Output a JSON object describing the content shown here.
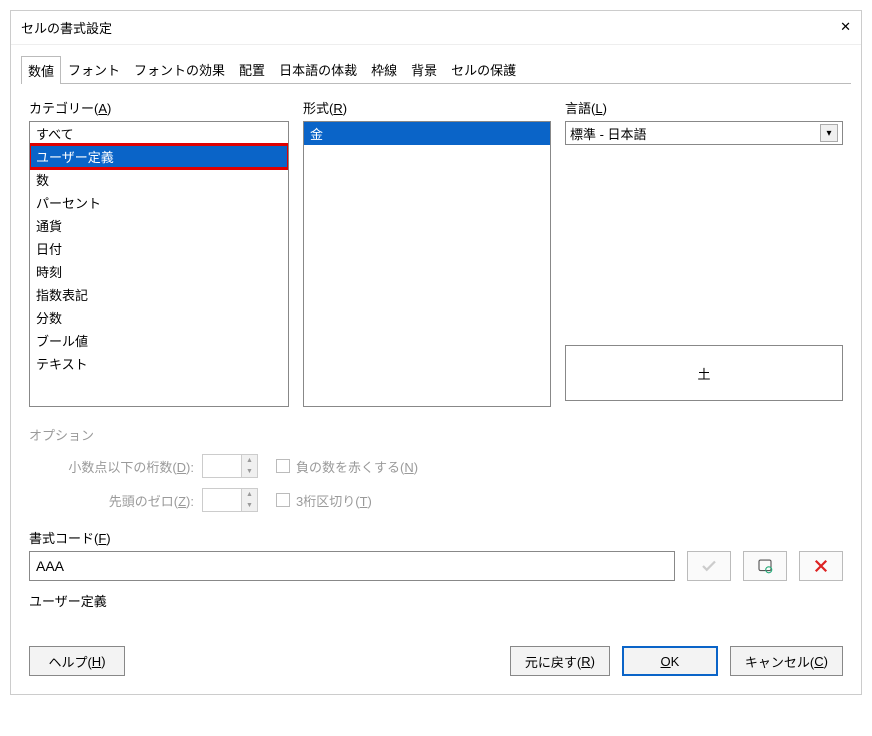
{
  "window": {
    "title": "セルの書式設定"
  },
  "tabs": [
    {
      "label": "数値",
      "active": true
    },
    {
      "label": "フォント"
    },
    {
      "label": "フォントの効果"
    },
    {
      "label": "配置"
    },
    {
      "label": "日本語の体裁"
    },
    {
      "label": "枠線"
    },
    {
      "label": "背景"
    },
    {
      "label": "セルの保護"
    }
  ],
  "labels": {
    "category": "カテゴリー(",
    "category_u": "A",
    "category_end": ")",
    "format": "形式(",
    "format_u": "R",
    "format_end": ")",
    "language": "言語(",
    "language_u": "L",
    "language_end": ")",
    "options": "オプション",
    "decimal": "小数点以下の桁数(",
    "decimal_u": "D",
    "decimal_end": "):",
    "lead_zero": "先頭のゼロ(",
    "lead_zero_u": "Z",
    "lead_zero_end": "):",
    "neg_red": "負の数を赤くする(",
    "neg_red_u": "N",
    "neg_red_end": ")",
    "thou_sep": "3桁区切り(",
    "thou_sep_u": "T",
    "thou_sep_end": ")",
    "format_code": "書式コード(",
    "format_code_u": "F",
    "format_code_end": ")",
    "code_sub": "ユーザー定義"
  },
  "category": {
    "items": [
      "すべて",
      "ユーザー定義",
      "数",
      "パーセント",
      "通貨",
      "日付",
      "時刻",
      "指数表記",
      "分数",
      "ブール値",
      "テキスト"
    ],
    "selected_index": 1,
    "highlight_index": 1
  },
  "format": {
    "items": [
      "金"
    ],
    "selected_index": 0
  },
  "language": {
    "value": "標準 - 日本語"
  },
  "preview": {
    "value": "土"
  },
  "code": {
    "value": "AAA"
  },
  "buttons": {
    "help": "ヘルプ(",
    "help_u": "H",
    "help_end": ")",
    "reset": "元に戻す(",
    "reset_u": "R",
    "reset_end": ")",
    "ok": "OK",
    "ok_u": "O",
    "cancel": "キャンセル(",
    "cancel_u": "C",
    "cancel_end": ")"
  }
}
